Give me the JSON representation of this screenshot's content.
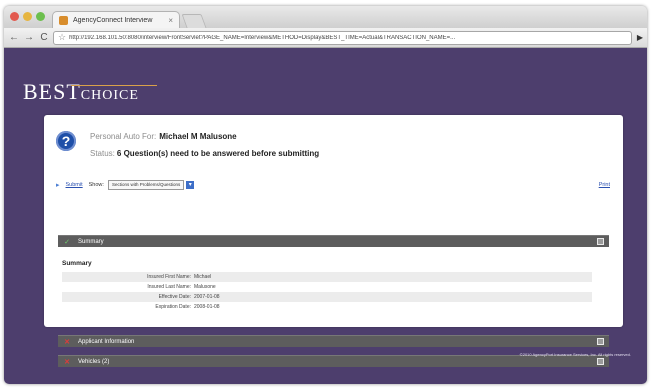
{
  "browser": {
    "tab_title": "AgencyConnect Interview",
    "tab_close": "×",
    "url": "http://192.168.101.50:8080/interview/FrontServlet?PAGE_NAME=Interview&METHOD=Display&BEST_TIME=Actual&TRANSACTION_NAME=...",
    "back": "←",
    "forward": "→",
    "reload": "C",
    "star": "☆",
    "menu": "▶"
  },
  "logo": {
    "best": "BEST",
    "choice": "CHOICE"
  },
  "header": {
    "label": "Personal Auto For:",
    "name": "Michael M Malusone",
    "status_label": "Status:",
    "status_text": "6 Question(s) need to be answered before submitting"
  },
  "toolbar": {
    "submit": "Submit",
    "show_label": "Show:",
    "show_value": "Sections with Problems/Questions",
    "print": "Print"
  },
  "sections": {
    "summary": "Summary",
    "applicant": "Applicant Information",
    "vehicles": "Vehicles (2)"
  },
  "summary": {
    "title": "Summary",
    "rows": [
      {
        "label": "Insured First Name:",
        "value": "Michael"
      },
      {
        "label": "Insured Last Name:",
        "value": "Malusone"
      },
      {
        "label": "Effective Date:",
        "value": "2007-01-08"
      },
      {
        "label": "Expiration Date:",
        "value": "2008-01-08"
      }
    ]
  },
  "footer": "©2010 AgencyPort Insurance Services, Inc. All rights reserved.",
  "colors": {
    "brand_purple": "#4d3e6d",
    "section_bar": "#5d5d5d",
    "link_blue": "#2a50b0"
  },
  "icons": {
    "help": "question-icon",
    "complete": "check-icon",
    "incomplete": "x-icon"
  }
}
